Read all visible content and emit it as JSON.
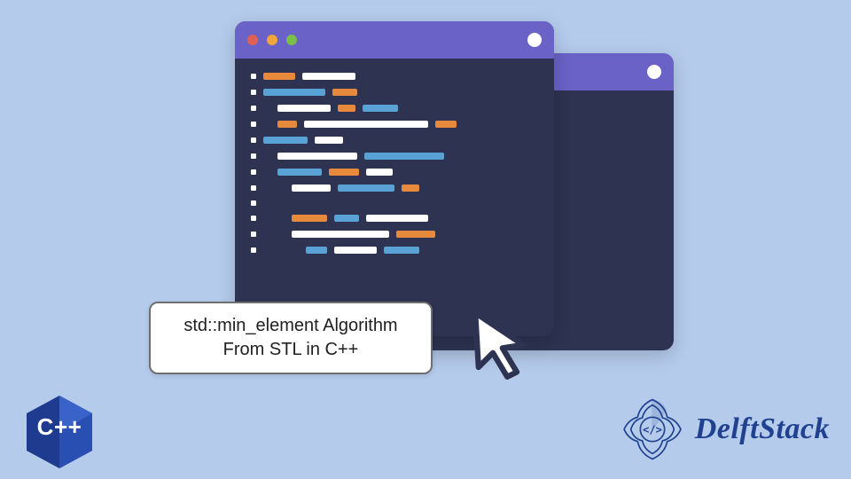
{
  "caption": {
    "line1": "std::min_element Algorithm",
    "line2": "From STL in C++"
  },
  "brand": {
    "name": "DelftStack"
  },
  "cpp_badge": {
    "label": "C++"
  },
  "colors": {
    "page_bg": "#b5cbec",
    "titlebar": "#6a62c6",
    "code_bg": "#2d3350",
    "accent_blue": "#5aa2d6",
    "accent_orange": "#e78a3e",
    "brand_blue": "#20418f"
  },
  "icons": {
    "traffic_lights": [
      "red",
      "yellow",
      "green"
    ],
    "cursor": "cursor-arrow-icon",
    "brand_glyph": "code-tag-icon"
  }
}
